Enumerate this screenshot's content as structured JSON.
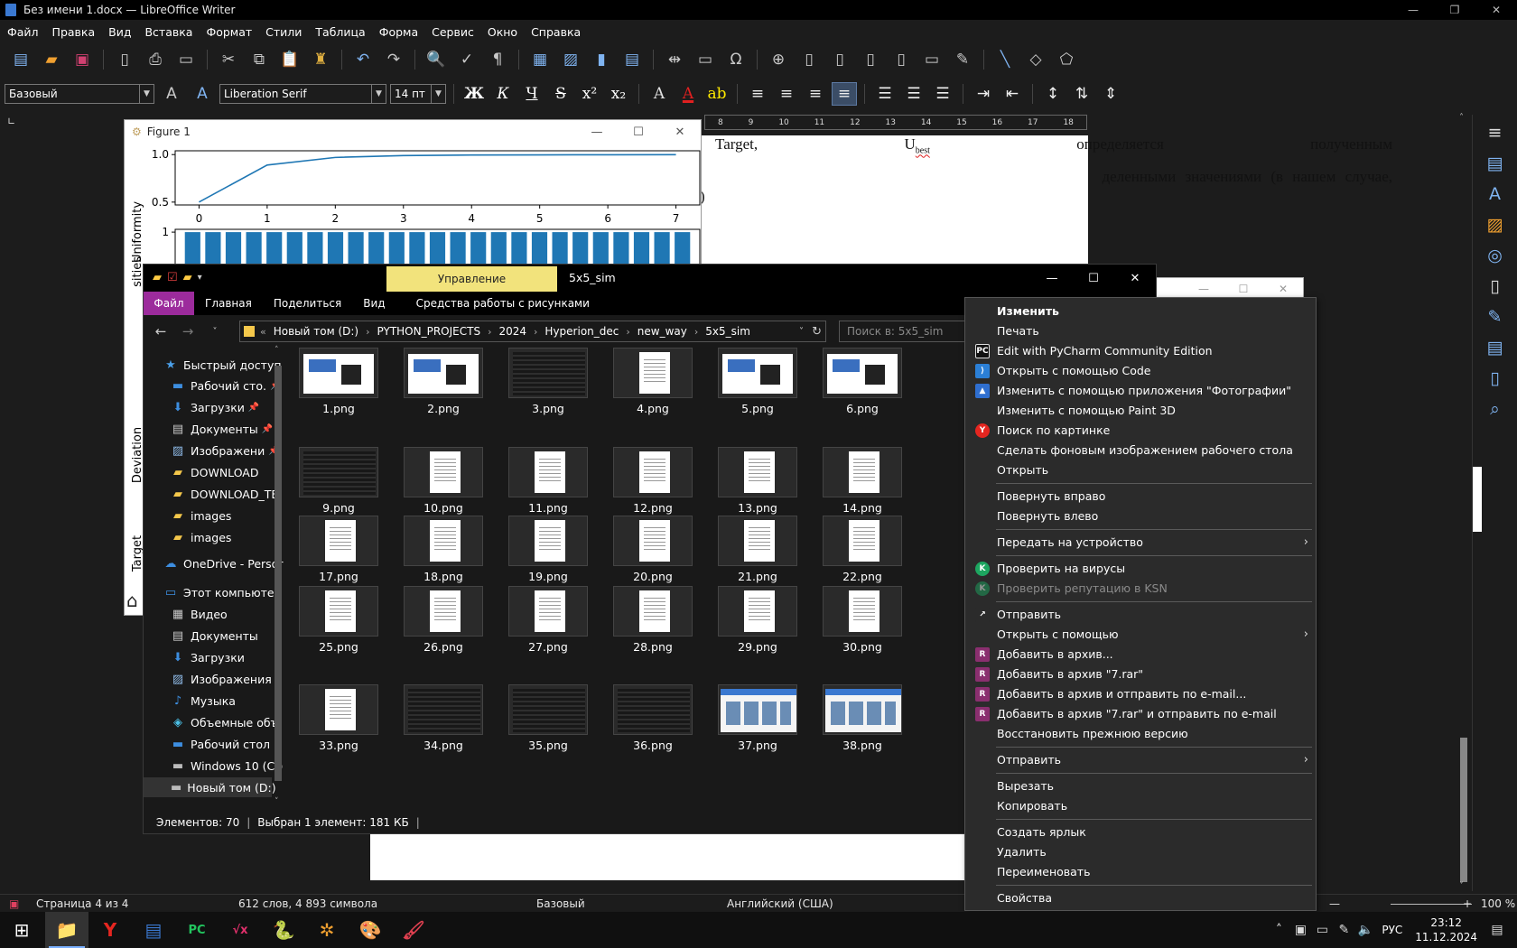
{
  "writer": {
    "title": "Без имени 1.docx — LibreOffice Writer",
    "win_min": "—",
    "win_restore": "❐",
    "win_close": "✕",
    "menu": [
      "Файл",
      "Правка",
      "Вид",
      "Вставка",
      "Формат",
      "Стили",
      "Таблица",
      "Форма",
      "Сервис",
      "Окно",
      "Справка"
    ],
    "paragraph_style": "Базовый",
    "font_name": "Liberation Serif",
    "font_size": "14 пт",
    "format_buttons": [
      "Ж",
      "К",
      "Ч",
      "S",
      "x²",
      "x₂"
    ],
    "ruler_marks": [
      "8",
      "9",
      "10",
      "11",
      "12",
      "13",
      "14",
      "15",
      "16",
      "17",
      "18"
    ],
    "doc_text": {
      "line1_a": "Target,",
      "line1_b": "U",
      "line1_sub": "best",
      "line1_c": "определяется",
      "line1_d": "полученным",
      "line2": "деленными значениями (в нашем случае,",
      "line3": ")"
    },
    "status": {
      "page": "Страница 4 из 4",
      "words": "612 слов, 4 893 символа",
      "style": "Базовый",
      "language": "Английский (США)",
      "zoom": "100 %"
    }
  },
  "figure": {
    "title": "Figure 1",
    "win_min": "—",
    "win_max": "☐",
    "win_close": "✕",
    "ylabel_top": "Uniformity",
    "ylabel_bottom": "sities",
    "ylabel_deviation": "Deviation",
    "ylabel_target": "Target",
    "yticks_top": [
      "1.0",
      "0.5"
    ],
    "xticks_top": [
      "0",
      "1",
      "2",
      "3",
      "4",
      "5",
      "6",
      "7"
    ],
    "ytick_bottom": "1",
    "line_color": "#1f77b4"
  },
  "chart_data": [
    {
      "type": "line",
      "ylabel": "Uniformity",
      "x": [
        0,
        1,
        2,
        3,
        4,
        5,
        6,
        7
      ],
      "values": [
        0.5,
        0.89,
        0.97,
        0.99,
        0.995,
        0.997,
        0.998,
        0.999
      ],
      "xlim": [
        -0.35,
        7.35
      ],
      "ylim": [
        0.47,
        1.04
      ]
    },
    {
      "type": "bar",
      "ylabel": "sities",
      "values": [
        1,
        1,
        1,
        1,
        1,
        1,
        1,
        1,
        1,
        1,
        1,
        1,
        1,
        1,
        1,
        1,
        1,
        1,
        1,
        1,
        1,
        1,
        1,
        1,
        1
      ],
      "ylim": [
        0,
        1.05
      ]
    }
  ],
  "explorer": {
    "title": "5x5_sim",
    "manage_tab": "Управление",
    "win_min": "—",
    "win_max": "☐",
    "win_close": "✕",
    "ribbon_tabs": [
      "Файл",
      "Главная",
      "Поделиться",
      "Вид",
      "Средства работы с рисунками"
    ],
    "breadcrumb": [
      "Новый том (D:)",
      "PYTHON_PROJECTS",
      "2024",
      "Hyperion_dec",
      "new_way",
      "5x5_sim"
    ],
    "breadcrumb_prefix": "«",
    "search_placeholder": "Поиск в: 5x5_sim",
    "nav": [
      {
        "label": "Быстрый доступ",
        "icon": "star-icon"
      },
      {
        "label": "Рабочий сто.",
        "icon": "desktop-icon",
        "pinned": true
      },
      {
        "label": "Загрузки",
        "icon": "download-icon",
        "pinned": true
      },
      {
        "label": "Документы",
        "icon": "documents-icon",
        "pinned": true
      },
      {
        "label": "Изображени",
        "icon": "pictures-icon",
        "pinned": true
      },
      {
        "label": "DOWNLOAD",
        "icon": "folder-icon"
      },
      {
        "label": "DOWNLOAD_TE",
        "icon": "folder-icon"
      },
      {
        "label": "images",
        "icon": "folder-icon"
      },
      {
        "label": "images",
        "icon": "folder-icon"
      },
      {
        "label": "OneDrive - Persor",
        "icon": "onedrive-icon"
      },
      {
        "label": "Этот компьютер",
        "icon": "computer-icon"
      },
      {
        "label": "Видео",
        "icon": "video-icon"
      },
      {
        "label": "Документы",
        "icon": "documents-icon"
      },
      {
        "label": "Загрузки",
        "icon": "download-icon"
      },
      {
        "label": "Изображения",
        "icon": "pictures-icon"
      },
      {
        "label": "Музыка",
        "icon": "music-icon"
      },
      {
        "label": "Объемные объ",
        "icon": "3d-objects-icon"
      },
      {
        "label": "Рабочий стол",
        "icon": "desktop-icon"
      },
      {
        "label": "Windows 10 (C:)",
        "icon": "drive-icon"
      },
      {
        "label": "Новый том (D:)",
        "icon": "drive-icon",
        "selected": true
      }
    ],
    "pin_glyph": "📌",
    "files": [
      {
        "name": "1.png",
        "kind": "shot"
      },
      {
        "name": "2.png",
        "kind": "shot"
      },
      {
        "name": "3.png",
        "kind": "dark"
      },
      {
        "name": "4.png",
        "kind": "page"
      },
      {
        "name": "5.png",
        "kind": "shot"
      },
      {
        "name": "6.png",
        "kind": "shot"
      },
      {
        "name": "9.png",
        "kind": "dark"
      },
      {
        "name": "10.png",
        "kind": "page"
      },
      {
        "name": "11.png",
        "kind": "page"
      },
      {
        "name": "12.png",
        "kind": "page"
      },
      {
        "name": "13.png",
        "kind": "page"
      },
      {
        "name": "14.png",
        "kind": "page"
      },
      {
        "name": "17.png",
        "kind": "page"
      },
      {
        "name": "18.png",
        "kind": "page"
      },
      {
        "name": "19.png",
        "kind": "page"
      },
      {
        "name": "20.png",
        "kind": "page"
      },
      {
        "name": "21.png",
        "kind": "page"
      },
      {
        "name": "22.png",
        "kind": "page"
      },
      {
        "name": "25.png",
        "kind": "page"
      },
      {
        "name": "26.png",
        "kind": "page"
      },
      {
        "name": "27.png",
        "kind": "page"
      },
      {
        "name": "28.png",
        "kind": "page"
      },
      {
        "name": "29.png",
        "kind": "page"
      },
      {
        "name": "30.png",
        "kind": "page"
      },
      {
        "name": "33.png",
        "kind": "page"
      },
      {
        "name": "34.png",
        "kind": "dark"
      },
      {
        "name": "35.png",
        "kind": "dark"
      },
      {
        "name": "36.png",
        "kind": "dark"
      },
      {
        "name": "37.png",
        "kind": "web"
      },
      {
        "name": "38.png",
        "kind": "web"
      }
    ],
    "status_count": "Элементов: 70",
    "status_selected": "Выбран 1 элемент: 181 КБ"
  },
  "context_menu": [
    {
      "label": "Изменить",
      "bold": true
    },
    {
      "label": "Печать"
    },
    {
      "label": "Edit with PyCharm Community Edition",
      "icon": "pycharm-icon",
      "icon_text": "PC",
      "icon_color": "#111111"
    },
    {
      "label": "Открыть с помощью Code",
      "icon": "vscode-icon",
      "icon_text": "⟩",
      "icon_color": "#2b7fd6"
    },
    {
      "label": "Изменить с помощью приложения \"Фотографии\"",
      "icon": "photos-icon",
      "icon_text": "▲",
      "icon_color": "#2f6fd0"
    },
    {
      "label": "Изменить с помощью Paint 3D"
    },
    {
      "label": "Поиск по картинке",
      "icon": "yandex-icon",
      "icon_text": "Y",
      "icon_color": "#e52620"
    },
    {
      "label": "Сделать фоновым изображением рабочего стола"
    },
    {
      "label": "Открыть"
    },
    {
      "separator": true
    },
    {
      "label": "Повернуть вправо"
    },
    {
      "label": "Повернуть влево"
    },
    {
      "separator": true
    },
    {
      "label": "Передать на устройство",
      "submenu": true
    },
    {
      "separator": true
    },
    {
      "label": "Проверить на вирусы",
      "icon": "kaspersky-icon",
      "icon_text": "K",
      "icon_color": "#1da660"
    },
    {
      "label": "Проверить репутацию в KSN",
      "icon": "kaspersky-icon",
      "icon_text": "K",
      "icon_color": "#1da660",
      "disabled": true
    },
    {
      "separator": true
    },
    {
      "label": "Отправить",
      "icon": "share-icon",
      "icon_text": "↗",
      "icon_color": "#2b2b2b"
    },
    {
      "label": "Открыть с помощью",
      "submenu": true
    },
    {
      "label": "Добавить в архив...",
      "icon": "winrar-icon",
      "icon_text": "R",
      "icon_color": "#8a2f6f"
    },
    {
      "label": "Добавить в архив \"7.rar\"",
      "icon": "winrar-icon",
      "icon_text": "R",
      "icon_color": "#8a2f6f"
    },
    {
      "label": "Добавить в архив и отправить по e-mail...",
      "icon": "winrar-icon",
      "icon_text": "R",
      "icon_color": "#8a2f6f"
    },
    {
      "label": "Добавить в архив \"7.rar\" и отправить по e-mail",
      "icon": "winrar-icon",
      "icon_text": "R",
      "icon_color": "#8a2f6f"
    },
    {
      "label": "Восстановить прежнюю версию"
    },
    {
      "separator": true
    },
    {
      "label": "Отправить",
      "submenu": true
    },
    {
      "separator": true
    },
    {
      "label": "Вырезать"
    },
    {
      "label": "Копировать"
    },
    {
      "separator": true
    },
    {
      "label": "Создать ярлык"
    },
    {
      "label": "Удалить"
    },
    {
      "label": "Переименовать"
    },
    {
      "separator": true
    },
    {
      "label": "Свойства"
    }
  ],
  "taskbar": {
    "start_glyph": "⊞",
    "apps": [
      {
        "name": "explorer-icon",
        "glyph": "📁",
        "active": true
      },
      {
        "name": "yandex-browser-icon",
        "glyph": "Y"
      },
      {
        "name": "writer-icon",
        "glyph": "▤"
      },
      {
        "name": "pycharm-icon",
        "glyph": "PC"
      },
      {
        "name": "math-icon",
        "glyph": "√x"
      },
      {
        "name": "python-icon",
        "glyph": "🐍"
      },
      {
        "name": "pinwheel-icon",
        "glyph": "✲"
      },
      {
        "name": "paint-icon",
        "glyph": "🎨"
      },
      {
        "name": "palette-icon",
        "glyph": "🖌"
      }
    ],
    "tray_chevron": "˄",
    "tray_lang": "РУС",
    "time": "23:12",
    "date": "11.12.2024"
  },
  "colors": {
    "accent_blue": "#7fb3f0",
    "explorer_manage_tab": "#f2e37c",
    "explorer_file_tab": "#9c2b9c",
    "folder_yellow": "#f5c84b",
    "font_color_red": "#e02020",
    "highlight_yellow": "#ffea00"
  }
}
